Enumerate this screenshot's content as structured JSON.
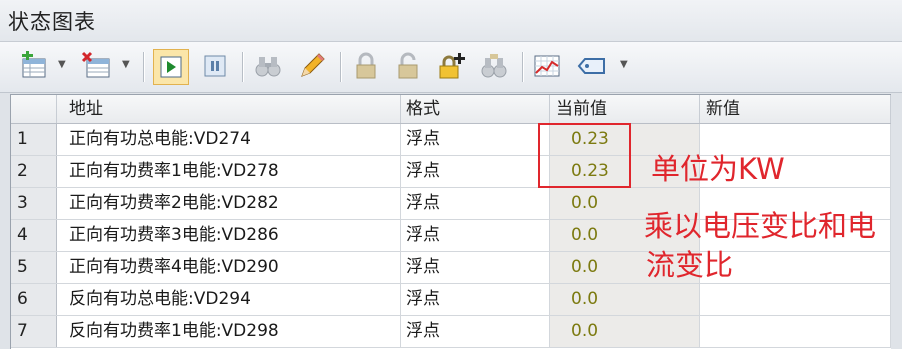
{
  "window": {
    "title": "状态图表"
  },
  "toolbar": {
    "buttons": [
      {
        "icon": "insert-row-icon",
        "has_dropdown": true
      },
      {
        "icon": "delete-row-icon",
        "has_dropdown": true
      },
      {
        "icon": "play-icon",
        "active": true
      },
      {
        "icon": "pause-icon"
      },
      {
        "icon": "binoculars-icon",
        "disabled": true
      },
      {
        "icon": "pencil-icon"
      },
      {
        "icon": "lock-icon",
        "disabled": true
      },
      {
        "icon": "unlock-icon",
        "disabled": true
      },
      {
        "icon": "lock-add-icon"
      },
      {
        "icon": "read-all-icon",
        "disabled": true
      },
      {
        "icon": "trend-chart-icon"
      },
      {
        "icon": "tag-icon",
        "has_dropdown": true
      }
    ]
  },
  "table": {
    "headers": {
      "rownum": "",
      "address": "地址",
      "format": "格式",
      "current": "当前值",
      "new": "新值"
    },
    "rows": [
      {
        "n": "1",
        "address": "正向有功总电能:VD274",
        "format": "浮点",
        "current": "0.23",
        "new": ""
      },
      {
        "n": "2",
        "address": "正向有功费率1电能:VD278",
        "format": "浮点",
        "current": "0.23",
        "new": ""
      },
      {
        "n": "3",
        "address": "正向有功费率2电能:VD282",
        "format": "浮点",
        "current": "0.0",
        "new": ""
      },
      {
        "n": "4",
        "address": "正向有功费率3电能:VD286",
        "format": "浮点",
        "current": "0.0",
        "new": ""
      },
      {
        "n": "5",
        "address": "正向有功费率4电能:VD290",
        "format": "浮点",
        "current": "0.0",
        "new": ""
      },
      {
        "n": "6",
        "address": "反向有功总电能:VD294",
        "format": "浮点",
        "current": "0.0",
        "new": ""
      },
      {
        "n": "7",
        "address": "反向有功费率1电能:VD298",
        "format": "浮点",
        "current": "0.0",
        "new": ""
      }
    ]
  },
  "annotations": {
    "unit": "单位为KW",
    "multiply_line1": "乘以电压变比和电",
    "multiply_line2": "流变比",
    "color": "#e0262d"
  }
}
